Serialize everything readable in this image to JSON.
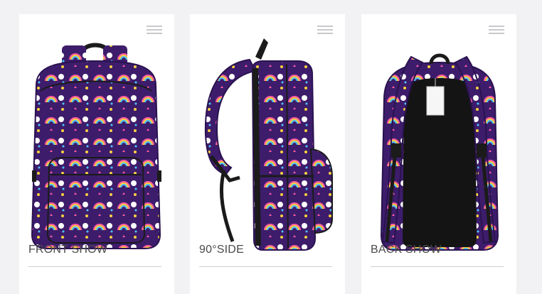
{
  "background_color": "#f2f2f4",
  "cards": [
    {
      "caption": "FRONT SHOW",
      "menu_icon": "hamburger-menu-icon",
      "image": "backpack-front-view"
    },
    {
      "caption": "90°SIDE",
      "menu_icon": "hamburger-menu-icon",
      "image": "backpack-side-view"
    },
    {
      "caption": "BACK SHOW",
      "menu_icon": "hamburger-menu-icon",
      "image": "backpack-back-view"
    }
  ],
  "colors": {
    "fabric": "#3d1d6b",
    "fabric_dark": "#2a1250",
    "strap": "#1b1b1b",
    "accent_pink": "#ff5aa5",
    "accent_blue": "#4fc8ff",
    "accent_yellow": "#ffd23f"
  }
}
